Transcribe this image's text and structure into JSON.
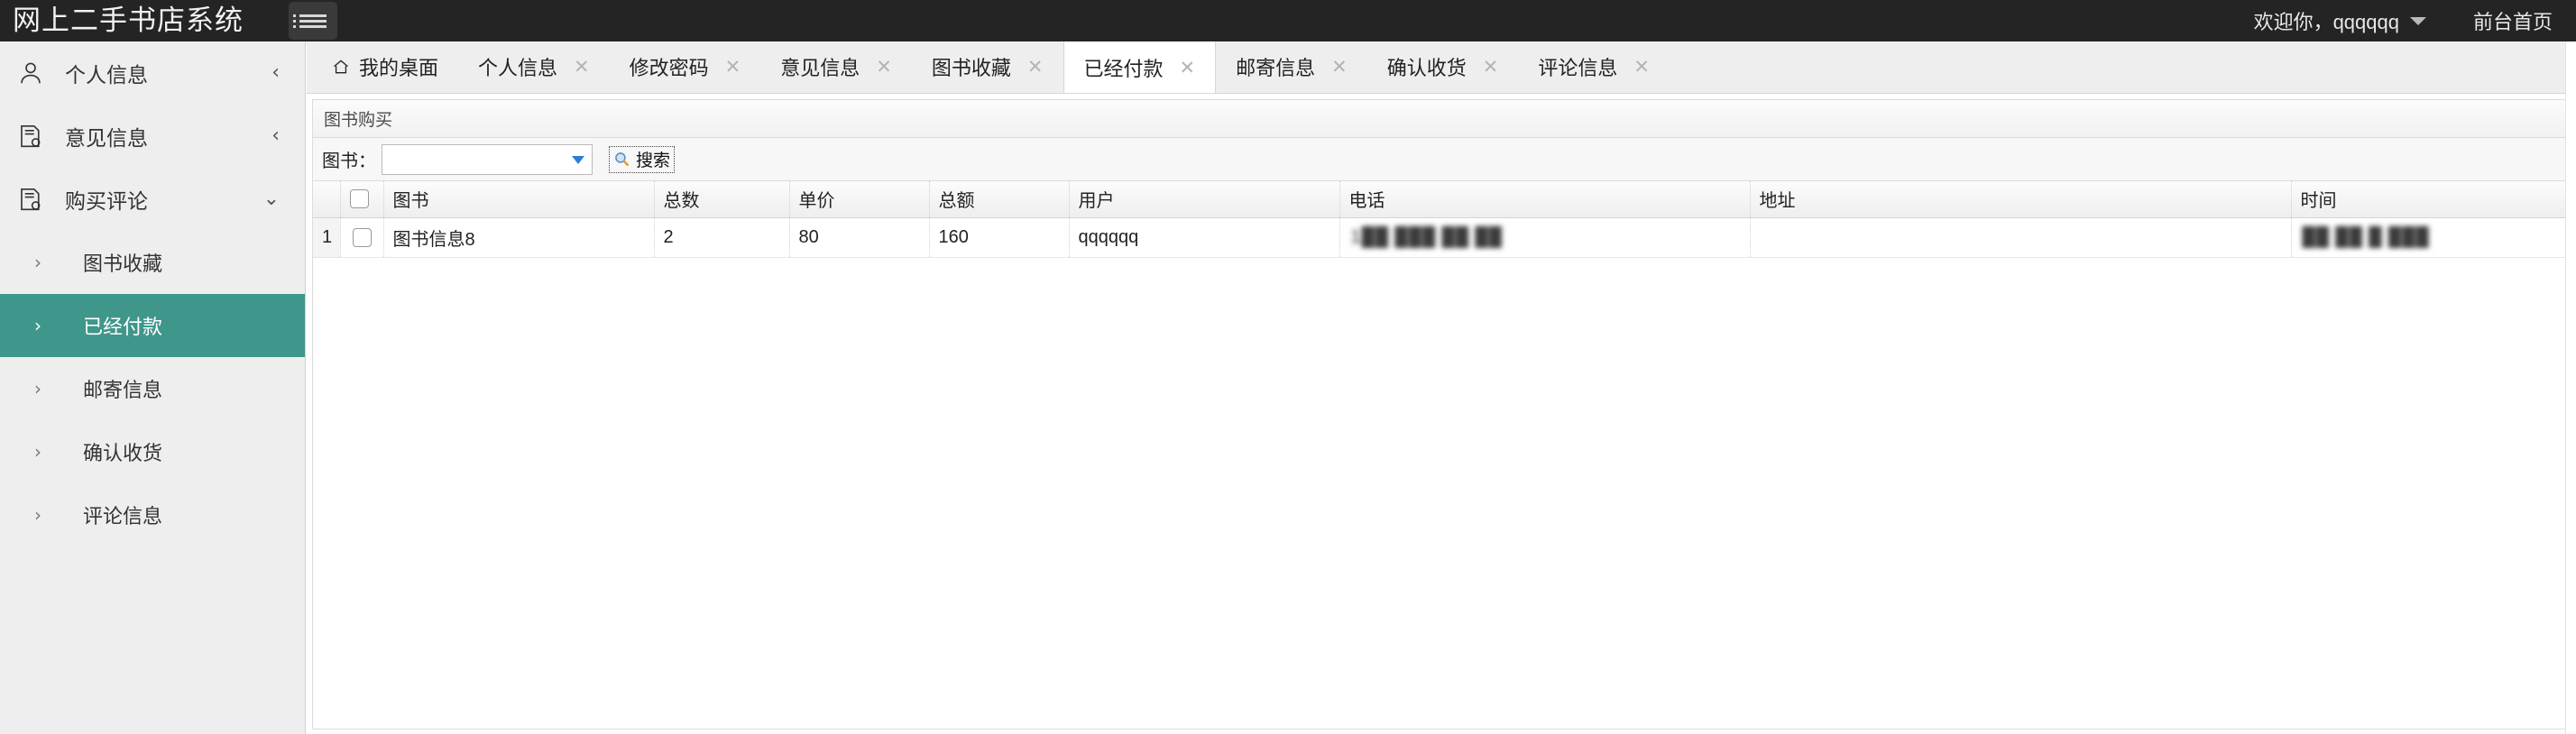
{
  "header": {
    "brand": "网上二手书店系统",
    "menu_icon": "list-menu-icon",
    "welcome": "欢迎你，qqqqqq",
    "front_home": "前台首页"
  },
  "sidebar": {
    "groups": [
      {
        "label": "个人信息",
        "icon": "user-icon",
        "chevron": "‹",
        "expanded": false
      },
      {
        "label": "意见信息",
        "icon": "document-icon",
        "chevron": "‹",
        "expanded": false
      },
      {
        "label": "购买评论",
        "icon": "document-icon",
        "chevron": "⌄",
        "expanded": true
      }
    ],
    "sub_items": [
      {
        "label": "图书收藏",
        "active": false
      },
      {
        "label": "已经付款",
        "active": true
      },
      {
        "label": "邮寄信息",
        "active": false
      },
      {
        "label": "确认收货",
        "active": false
      },
      {
        "label": "评论信息",
        "active": false
      }
    ],
    "active_color": "#3f968a"
  },
  "tabs": [
    {
      "label": "我的桌面",
      "icon": "home-icon",
      "closable": false,
      "active": false
    },
    {
      "label": "个人信息",
      "closable": true,
      "active": false
    },
    {
      "label": "修改密码",
      "closable": true,
      "active": false
    },
    {
      "label": "意见信息",
      "closable": true,
      "active": false
    },
    {
      "label": "图书收藏",
      "closable": true,
      "active": false
    },
    {
      "label": "已经付款",
      "closable": true,
      "active": true
    },
    {
      "label": "邮寄信息",
      "closable": true,
      "active": false
    },
    {
      "label": "确认收货",
      "closable": true,
      "active": false
    },
    {
      "label": "评论信息",
      "closable": true,
      "active": false
    }
  ],
  "panel": {
    "title": "图书购买",
    "toolbar": {
      "book_label": "图书：",
      "book_value": "",
      "book_placeholder": "",
      "search_label": "搜索",
      "search_icon": "magnifier-icon"
    },
    "table": {
      "columns": [
        "图书",
        "总数",
        "单价",
        "总额",
        "用户",
        "电话",
        "地址",
        "时间"
      ],
      "rows": [
        {
          "index": "1",
          "checked": false,
          "book": "图书信息8",
          "count": "2",
          "unit_price": "80",
          "total": "160",
          "user": "qqqqqq",
          "phone": "1██ ███ ██ ██",
          "address": "",
          "time": "██ ██ █ ███"
        }
      ]
    }
  },
  "close_glyph": "✕"
}
